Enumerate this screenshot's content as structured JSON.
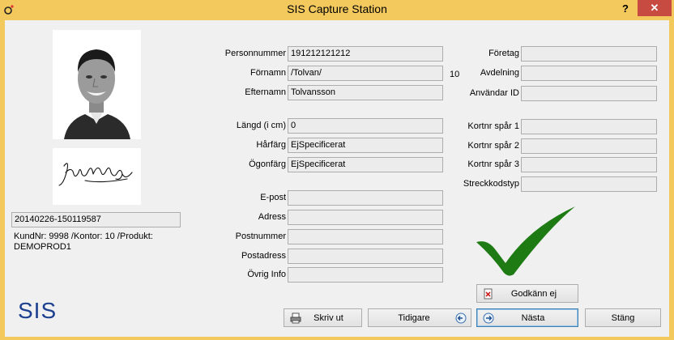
{
  "window": {
    "title": "SIS Capture Station",
    "help_label": "?",
    "close_label": "✕"
  },
  "person": {
    "id_number": "20140226-150119587",
    "info_line1": "KundNr: 9998 /Kontor: 10 /Produkt:",
    "info_line2": "DEMOPROD1"
  },
  "fields_left": [
    {
      "label": "Personnummer",
      "value": "191212121212"
    },
    {
      "label": "Förnamn",
      "value": "/Tolvan/"
    },
    {
      "label": "Efternamn",
      "value": "Tolvansson"
    },
    {
      "label": "Längd (i cm)",
      "value": "0"
    },
    {
      "label": "Hårfärg",
      "value": "EjSpecificerat"
    },
    {
      "label": "Ögonfärg",
      "value": "EjSpecificerat"
    },
    {
      "label": "E-post",
      "value": ""
    },
    {
      "label": "Adress",
      "value": ""
    },
    {
      "label": "Postnummer",
      "value": ""
    },
    {
      "label": "Postadress",
      "value": ""
    },
    {
      "label": "Övrig Info",
      "value": ""
    }
  ],
  "fields_right": [
    {
      "label": "Företag",
      "value": ""
    },
    {
      "label": "Avdelning",
      "value": ""
    },
    {
      "label": "Användar ID",
      "value": ""
    },
    {
      "label": "Kortnr spår 1",
      "value": ""
    },
    {
      "label": "Kortnr spår 2",
      "value": ""
    },
    {
      "label": "Kortnr spår 3",
      "value": ""
    },
    {
      "label": "Streckkodstyp",
      "value": ""
    }
  ],
  "avdelning_number": "10",
  "logo_text": "SIS",
  "buttons": {
    "reject_label": "Godkänn ej",
    "print_label": "Skriv ut",
    "previous_label": "Tidigare",
    "next_label": "Nästa",
    "close_label": "Stäng"
  },
  "colors": {
    "title_bar": "#f3c95e",
    "close_button": "#c74b40",
    "check_mark": "#1e7b13",
    "logo": "#1c3f8f"
  }
}
